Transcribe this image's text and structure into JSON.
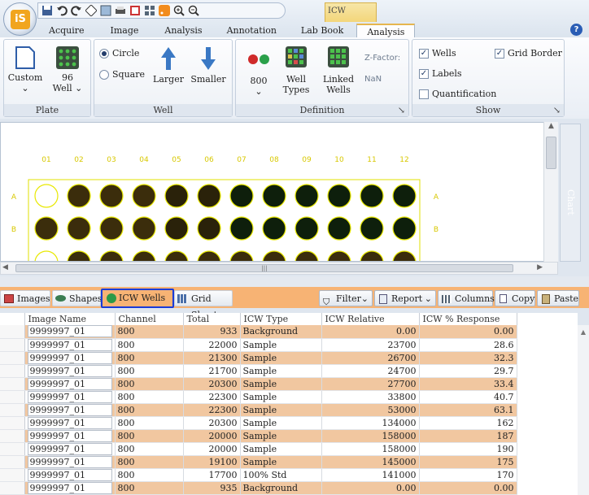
{
  "app": {
    "logo": "iS",
    "context_group": "ICW"
  },
  "tabs": [
    "Acquire",
    "Image",
    "Analysis",
    "Annotation",
    "Lab Book",
    "Analysis"
  ],
  "ribbon": {
    "plate": {
      "label": "Plate",
      "custom": "Custom",
      "wells96_top": "96",
      "wells96_bot": "Well"
    },
    "well": {
      "label": "Well",
      "circle": "Circle",
      "square": "Square",
      "larger": "Larger",
      "smaller": "Smaller"
    },
    "definition": {
      "label": "Definition",
      "c800": "800",
      "well_types_top": "Well",
      "well_types_bot": "Types",
      "linked_top": "Linked",
      "linked_bot": "Wells",
      "zfactor": "Z-Factor:",
      "zvalue": "NaN"
    },
    "show": {
      "label": "Show",
      "wells": "Wells",
      "labels": "Labels",
      "quant": "Quantification",
      "grid_border": "Grid Border"
    }
  },
  "plate": {
    "cols": [
      "01",
      "02",
      "03",
      "04",
      "05",
      "06",
      "07",
      "08",
      "09",
      "10",
      "11",
      "12"
    ],
    "rows": [
      "A",
      "B"
    ],
    "chart_tab": "Chart"
  },
  "lower_tabs": {
    "images": "Images",
    "shapes": "Shapes",
    "icw_wells": "ICW Wells",
    "grid_sheet": "Grid Sheet"
  },
  "toolbar": {
    "filter": "Filter",
    "report": "Report",
    "columns": "Columns",
    "copy": "Copy",
    "paste": "Paste"
  },
  "table": {
    "headers": [
      "Image Name",
      "Channel",
      "Total",
      "ICW Type",
      "ICW Relative",
      "ICW % Response"
    ],
    "rows": [
      [
        "9999997_01",
        "800",
        "933",
        "Background",
        "0.00",
        "0.00"
      ],
      [
        "9999997_01",
        "800",
        "22000",
        "Sample",
        "23700",
        "28.6"
      ],
      [
        "9999997_01",
        "800",
        "21300",
        "Sample",
        "26700",
        "32.3"
      ],
      [
        "9999997_01",
        "800",
        "21700",
        "Sample",
        "24700",
        "29.7"
      ],
      [
        "9999997_01",
        "800",
        "20300",
        "Sample",
        "27700",
        "33.4"
      ],
      [
        "9999997_01",
        "800",
        "22300",
        "Sample",
        "33800",
        "40.7"
      ],
      [
        "9999997_01",
        "800",
        "22300",
        "Sample",
        "53000",
        "63.1"
      ],
      [
        "9999997_01",
        "800",
        "20300",
        "Sample",
        "134000",
        "162"
      ],
      [
        "9999997_01",
        "800",
        "20000",
        "Sample",
        "158000",
        "187"
      ],
      [
        "9999997_01",
        "800",
        "20000",
        "Sample",
        "158000",
        "190"
      ],
      [
        "9999997_01",
        "800",
        "19100",
        "Sample",
        "145000",
        "175"
      ],
      [
        "9999997_01",
        "800",
        "17700",
        "100% Std",
        "141000",
        "170"
      ],
      [
        "9999997_01",
        "800",
        "935",
        "Background",
        "0.00",
        "0.00"
      ]
    ]
  }
}
